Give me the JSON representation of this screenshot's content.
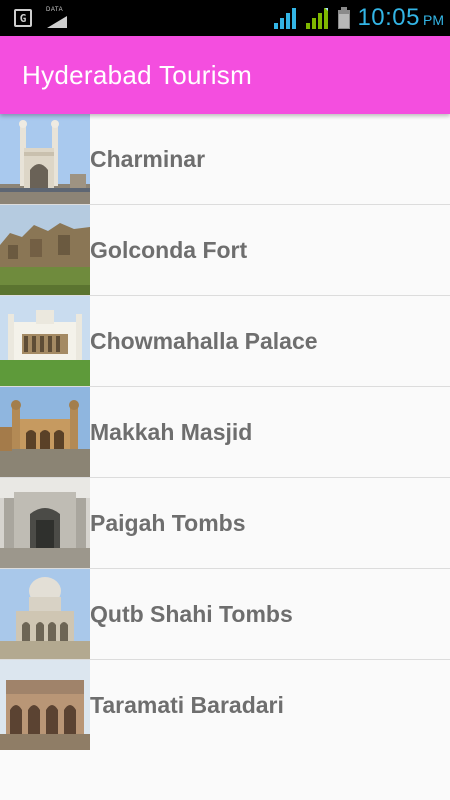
{
  "status_bar": {
    "time": "10:05",
    "ampm": "PM",
    "data_label": "DATA",
    "accent_color": "#33b5e5"
  },
  "app_bar": {
    "title": "Hyderabad Tourism",
    "color": "#f44edf"
  },
  "places": [
    {
      "name": "Charminar"
    },
    {
      "name": "Golconda Fort"
    },
    {
      "name": "Chowmahalla Palace"
    },
    {
      "name": "Makkah Masjid"
    },
    {
      "name": "Paigah Tombs"
    },
    {
      "name": "Qutb Shahi Tombs"
    },
    {
      "name": "Taramati Baradari"
    }
  ]
}
